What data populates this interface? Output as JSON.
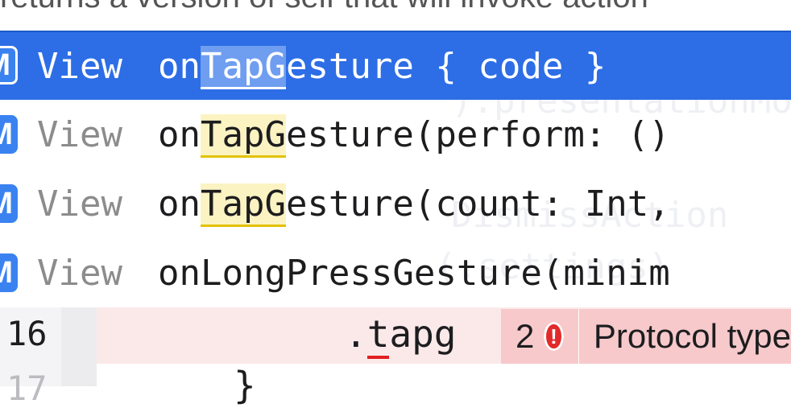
{
  "doc_text": "returns a version of self that will invoke action",
  "ghost_lines": [
    "@Environment(\\.presentationMode",
    ").presentationMode",
    "DismissAction",
    "(.settings)"
  ],
  "completions": [
    {
      "badge": "M",
      "type": "View",
      "prefix": "on",
      "match": "TapG",
      "suffix": "esture { code }",
      "selected": true
    },
    {
      "badge": "M",
      "type": "View",
      "prefix": "on",
      "match": "TapG",
      "suffix": "esture(perform: ()",
      "selected": false
    },
    {
      "badge": "M",
      "type": "View",
      "prefix": "on",
      "match": "TapG",
      "suffix": "esture(count: Int,",
      "selected": false
    },
    {
      "badge": "M",
      "type": "View",
      "prefix": "",
      "match": "",
      "suffix": "onLongPressGesture(minim",
      "selected": false
    }
  ],
  "editor": {
    "line_number": "16",
    "next_line_number": "17",
    "code_dot": ".",
    "code_err": "t",
    "code_rest": "apg",
    "next_code": "}",
    "issue_count": "2",
    "issue_icon": "!",
    "issue_message": "Protocol type"
  },
  "colors": {
    "selection": "#2d6ee6",
    "match_highlight": "#fbf3c2",
    "error_background": "#f7c9cb",
    "error_icon": "#e22a2a"
  }
}
